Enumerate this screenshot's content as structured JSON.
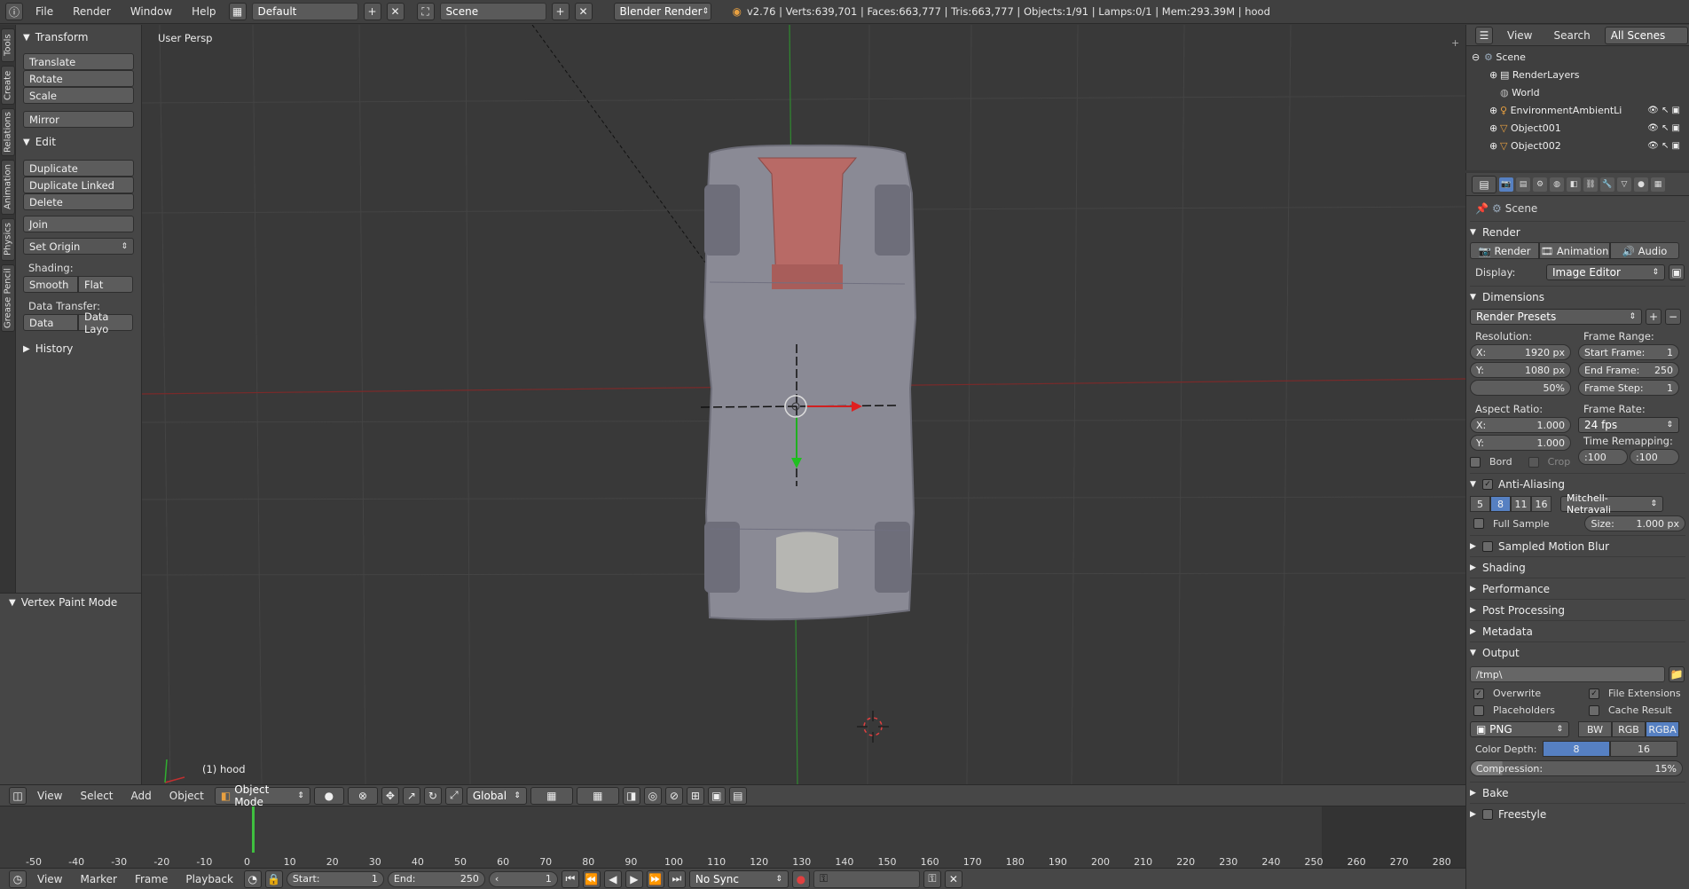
{
  "topbar": {
    "menus": [
      "File",
      "Render",
      "Window",
      "Help"
    ],
    "layout": "Default",
    "scene": "Scene",
    "engine": "Blender Render",
    "stats": "v2.76 | Verts:639,701 | Faces:663,777 | Tris:663,777 | Objects:1/91 | Lamps:0/1 | Mem:293.39M | hood"
  },
  "tabs": [
    "Tools",
    "Create",
    "Relations",
    "Animation",
    "Physics",
    "Grease Pencil"
  ],
  "toolshelf": {
    "transform": "Transform",
    "translate": "Translate",
    "rotate": "Rotate",
    "scale": "Scale",
    "mirror": "Mirror",
    "edit": "Edit",
    "duplicate": "Duplicate",
    "duplicate_linked": "Duplicate Linked",
    "delete": "Delete",
    "join": "Join",
    "set_origin": "Set Origin",
    "shading": "Shading:",
    "smooth": "Smooth",
    "flat": "Flat",
    "data_transfer": "Data Transfer:",
    "data": "Data",
    "data_layo": "Data Layo",
    "history": "History"
  },
  "vertex_paint": "Vertex Paint Mode",
  "viewport": {
    "label": "User Persp",
    "object": "(1) hood"
  },
  "viewhead": {
    "view": "View",
    "select": "Select",
    "add": "Add",
    "object": "Object",
    "mode": "Object Mode",
    "orientation": "Global"
  },
  "timeline": {
    "ticks": [
      "-50",
      "-40",
      "-30",
      "-20",
      "-10",
      "0",
      "10",
      "20",
      "30",
      "40",
      "50",
      "60",
      "70",
      "80",
      "90",
      "100",
      "110",
      "120",
      "130",
      "140",
      "150",
      "160",
      "170",
      "180",
      "190",
      "200",
      "210",
      "220",
      "230",
      "240",
      "250",
      "260",
      "270",
      "280"
    ],
    "view": "View",
    "marker": "Marker",
    "frame": "Frame",
    "playback": "Playback",
    "start_label": "Start:",
    "start": "1",
    "end_label": "End:",
    "end": "250",
    "current": "1",
    "sync": "No Sync"
  },
  "outliner": {
    "view": "View",
    "search": "Search",
    "filter": "All Scenes",
    "items": [
      "Scene",
      "RenderLayers",
      "World",
      "EnvironmentAmbientLi",
      "Object001",
      "Object002"
    ]
  },
  "props": {
    "scene": "Scene",
    "render": "Render",
    "render_btn": "Render",
    "animation_btn": "Animation",
    "audio_btn": "Audio",
    "display_label": "Display:",
    "display": "Image Editor",
    "dimensions": "Dimensions",
    "presets": "Render Presets",
    "resolution": "Resolution:",
    "res_x_l": "X:",
    "res_x": "1920 px",
    "res_y_l": "Y:",
    "res_y": "1080 px",
    "res_pct": "50%",
    "frame_range": "Frame Range:",
    "start_frame_l": "Start Frame:",
    "start_frame": "1",
    "end_frame_l": "End Frame:",
    "end_frame": "250",
    "frame_step_l": "Frame Step:",
    "frame_step": "1",
    "aspect": "Aspect Ratio:",
    "asp_x_l": "X:",
    "asp_x": "1.000",
    "asp_y_l": "Y:",
    "asp_y": "1.000",
    "frame_rate": "Frame Rate:",
    "fps": "24 fps",
    "time_remap": "Time Remapping:",
    "remap_old": ":100",
    "remap_new": ":100",
    "bord": "Bord",
    "crop": "Crop",
    "aa": "Anti-Aliasing",
    "aa_samples": [
      "5",
      "8",
      "11",
      "16"
    ],
    "aa_filter": "Mitchell-Netravali",
    "full_sample": "Full Sample",
    "size_l": "Size:",
    "size": "1.000 px",
    "sections": [
      "Sampled Motion Blur",
      "Shading",
      "Performance",
      "Post Processing",
      "Metadata"
    ],
    "output": "Output",
    "path": "/tmp\\",
    "overwrite": "Overwrite",
    "file_ext": "File Extensions",
    "placeholders": "Placeholders",
    "cache": "Cache Result",
    "format": "PNG",
    "bw": "BW",
    "rgb": "RGB",
    "rgba": "RGBA",
    "depth_l": "Color Depth:",
    "depth_8": "8",
    "depth_16": "16",
    "compression_l": "Compression:",
    "compression": "15%",
    "bake": "Bake",
    "freestyle": "Freestyle"
  },
  "colors": {
    "accent": "#5680c2",
    "x_axis": "#8b2a2a",
    "y_axis": "#2f8a2f",
    "car_body": "#8b8b95",
    "car_red": "#b86a66"
  }
}
